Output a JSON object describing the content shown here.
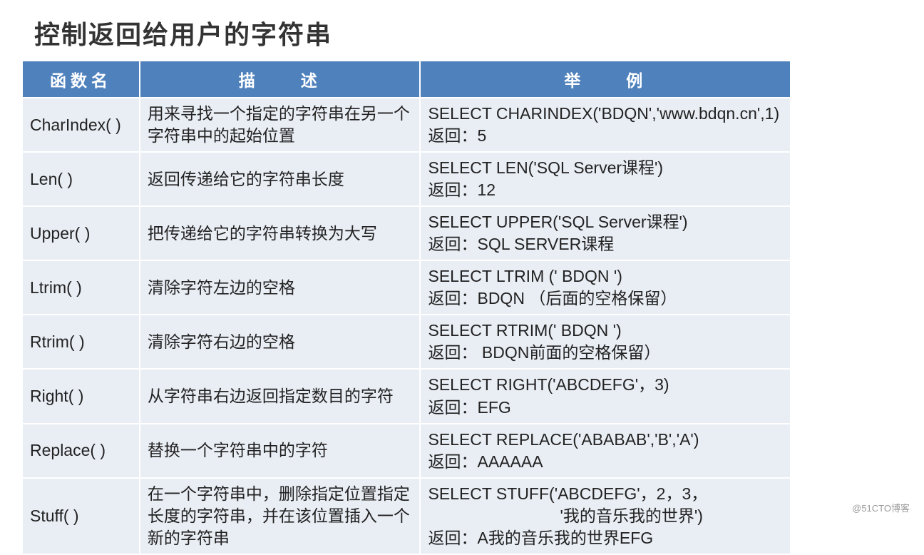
{
  "title": "控制返回给用户的字符串",
  "headers": {
    "name": "函数名",
    "desc": "描　　述",
    "example": "举　　例"
  },
  "rows": [
    {
      "name": "CharIndex( )",
      "desc": "用来寻找一个指定的字符串在另一个字符串中的起始位置",
      "ex1": "SELECT CHARINDEX('BDQN','www.bdqn.cn',1)",
      "ex2": "返回：5"
    },
    {
      "name": "Len( )",
      "desc": "返回传递给它的字符串长度",
      "ex1": "SELECT LEN('SQL Server课程')",
      "ex2": "返回：12"
    },
    {
      "name": "Upper( )",
      "desc": "把传递给它的字符串转换为大写",
      "ex1": "SELECT UPPER('SQL Server课程')",
      "ex2": "返回：SQL SERVER课程"
    },
    {
      "name": "Ltrim( )",
      "desc": "清除字符左边的空格",
      "ex1": "SELECT LTRIM ('  BDQN  ')",
      "ex2": "返回：BDQN  （后面的空格保留）"
    },
    {
      "name": "Rtrim( )",
      "desc": "清除字符右边的空格",
      "ex1": "SELECT RTRIM('  BDQN  ')",
      "ex2": "返回：   BDQN前面的空格保留）"
    },
    {
      "name": "Right( )",
      "desc": "从字符串右边返回指定数目的字符",
      "ex1": "SELECT RIGHT('ABCDEFG'，3)",
      "ex2": "返回：EFG"
    },
    {
      "name": "Replace( )",
      "desc": "替换一个字符串中的字符",
      "ex1": "SELECT REPLACE('ABABAB','B','A')",
      "ex2": "返回：AAAAAA"
    },
    {
      "name": "Stuff( )",
      "desc": "在一个字符串中，删除指定位置指定长度的字符串，并在该位置插入一个新的字符串",
      "ex1": "SELECT STUFF('ABCDEFG'，2，3，",
      "ex_mid": "'我的音乐我的世界')",
      "ex2": "返回：A我的音乐我的世界EFG"
    }
  ],
  "watermark": "@51CTO博客"
}
